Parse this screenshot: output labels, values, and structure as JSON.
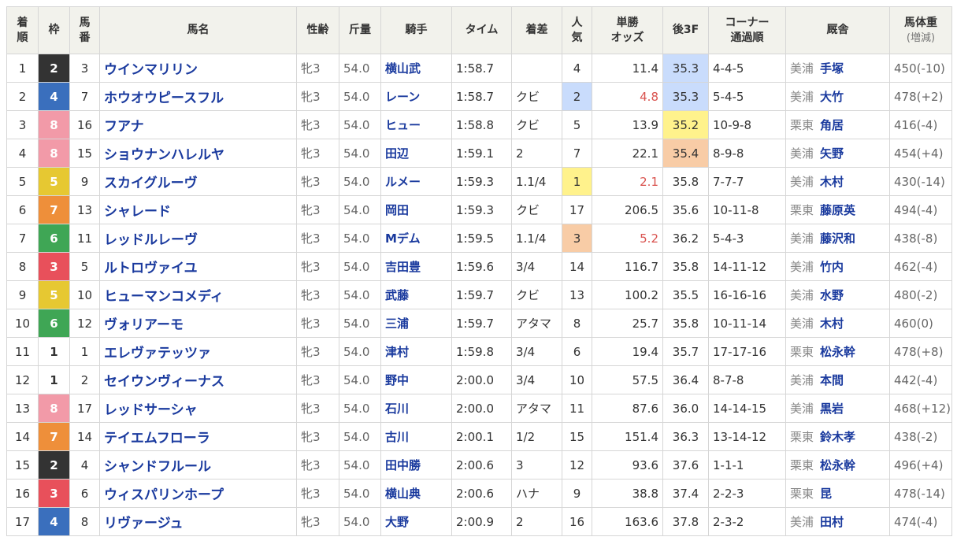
{
  "colors": {
    "waku": {
      "1": "#ffffff",
      "2": "#333333",
      "3": "#e8505b",
      "4": "#3a6fbd",
      "5": "#e6c832",
      "6": "#3fa655",
      "7": "#ee8f3a",
      "8": "#f29aa8"
    },
    "rank_highlight": {
      "1": "#fff28c",
      "2": "#c9dcfc",
      "3": "#f8cca6"
    },
    "link": "#1a3a9e",
    "favorite_odds": "#d9534f",
    "header_bg": "#f2f2ec"
  },
  "header": {
    "rank": [
      "着",
      "順"
    ],
    "waku": "枠",
    "umaban": [
      "馬",
      "番"
    ],
    "name": "馬名",
    "sex_age": "性齢",
    "weight": "斤量",
    "jockey": "騎手",
    "time": "タイム",
    "margin": "着差",
    "popularity": [
      "人",
      "気"
    ],
    "odds": [
      "単勝",
      "オッズ"
    ],
    "last3f": "後3F",
    "corners": [
      "コーナー",
      "通過順"
    ],
    "stable": "厩舎",
    "body_weight": [
      "馬体重",
      "(増減)"
    ]
  },
  "rows": [
    {
      "rank": "1",
      "waku": "2",
      "umaban": "3",
      "name": "ウインマリリン",
      "sex_age": "牝3",
      "weight": "54.0",
      "jockey": "横山武",
      "time": "1:58.7",
      "margin": "",
      "pop": "4",
      "odds": "11.4",
      "last3f": "35.3",
      "corners": "4-4-5",
      "loc": "美浦",
      "trainer": "手塚",
      "body": "450(-10)",
      "pop_rank": 0,
      "f3_rank": 2
    },
    {
      "rank": "2",
      "waku": "4",
      "umaban": "7",
      "name": "ホウオウピースフル",
      "sex_age": "牝3",
      "weight": "54.0",
      "jockey": "レーン",
      "time": "1:58.7",
      "margin": "クビ",
      "pop": "2",
      "odds": "4.8",
      "last3f": "35.3",
      "corners": "5-4-5",
      "loc": "美浦",
      "trainer": "大竹",
      "body": "478(+2)",
      "pop_rank": 2,
      "f3_rank": 2
    },
    {
      "rank": "3",
      "waku": "8",
      "umaban": "16",
      "name": "フアナ",
      "sex_age": "牝3",
      "weight": "54.0",
      "jockey": "ヒュー",
      "time": "1:58.8",
      "margin": "クビ",
      "pop": "5",
      "odds": "13.9",
      "last3f": "35.2",
      "corners": "10-9-8",
      "loc": "栗東",
      "trainer": "角居",
      "body": "416(-4)",
      "pop_rank": 0,
      "f3_rank": 1
    },
    {
      "rank": "4",
      "waku": "8",
      "umaban": "15",
      "name": "ショウナンハレルヤ",
      "sex_age": "牝3",
      "weight": "54.0",
      "jockey": "田辺",
      "time": "1:59.1",
      "margin": "2",
      "pop": "7",
      "odds": "22.1",
      "last3f": "35.4",
      "corners": "8-9-8",
      "loc": "美浦",
      "trainer": "矢野",
      "body": "454(+4)",
      "pop_rank": 0,
      "f3_rank": 3
    },
    {
      "rank": "5",
      "waku": "5",
      "umaban": "9",
      "name": "スカイグルーヴ",
      "sex_age": "牝3",
      "weight": "54.0",
      "jockey": "ルメー",
      "time": "1:59.3",
      "margin": "1.1/4",
      "pop": "1",
      "odds": "2.1",
      "last3f": "35.8",
      "corners": "7-7-7",
      "loc": "美浦",
      "trainer": "木村",
      "body": "430(-14)",
      "pop_rank": 1,
      "f3_rank": 0
    },
    {
      "rank": "6",
      "waku": "7",
      "umaban": "13",
      "name": "シャレード",
      "sex_age": "牝3",
      "weight": "54.0",
      "jockey": "岡田",
      "time": "1:59.3",
      "margin": "クビ",
      "pop": "17",
      "odds": "206.5",
      "last3f": "35.6",
      "corners": "10-11-8",
      "loc": "栗東",
      "trainer": "藤原英",
      "body": "494(-4)",
      "pop_rank": 0,
      "f3_rank": 0
    },
    {
      "rank": "7",
      "waku": "6",
      "umaban": "11",
      "name": "レッドルレーヴ",
      "sex_age": "牝3",
      "weight": "54.0",
      "jockey": "Mデム",
      "time": "1:59.5",
      "margin": "1.1/4",
      "pop": "3",
      "odds": "5.2",
      "last3f": "36.2",
      "corners": "5-4-3",
      "loc": "美浦",
      "trainer": "藤沢和",
      "body": "438(-8)",
      "pop_rank": 3,
      "f3_rank": 0
    },
    {
      "rank": "8",
      "waku": "3",
      "umaban": "5",
      "name": "ルトロヴァイユ",
      "sex_age": "牝3",
      "weight": "54.0",
      "jockey": "吉田豊",
      "time": "1:59.6",
      "margin": "3/4",
      "pop": "14",
      "odds": "116.7",
      "last3f": "35.8",
      "corners": "14-11-12",
      "loc": "美浦",
      "trainer": "竹内",
      "body": "462(-4)",
      "pop_rank": 0,
      "f3_rank": 0
    },
    {
      "rank": "9",
      "waku": "5",
      "umaban": "10",
      "name": "ヒューマンコメディ",
      "sex_age": "牝3",
      "weight": "54.0",
      "jockey": "武藤",
      "time": "1:59.7",
      "margin": "クビ",
      "pop": "13",
      "odds": "100.2",
      "last3f": "35.5",
      "corners": "16-16-16",
      "loc": "美浦",
      "trainer": "水野",
      "body": "480(-2)",
      "pop_rank": 0,
      "f3_rank": 0
    },
    {
      "rank": "10",
      "waku": "6",
      "umaban": "12",
      "name": "ヴォリアーモ",
      "sex_age": "牝3",
      "weight": "54.0",
      "jockey": "三浦",
      "time": "1:59.7",
      "margin": "アタマ",
      "pop": "8",
      "odds": "25.7",
      "last3f": "35.8",
      "corners": "10-11-14",
      "loc": "美浦",
      "trainer": "木村",
      "body": "460(0)",
      "pop_rank": 0,
      "f3_rank": 0
    },
    {
      "rank": "11",
      "waku": "1",
      "umaban": "1",
      "name": "エレヴァテッツァ",
      "sex_age": "牝3",
      "weight": "54.0",
      "jockey": "津村",
      "time": "1:59.8",
      "margin": "3/4",
      "pop": "6",
      "odds": "19.4",
      "last3f": "35.7",
      "corners": "17-17-16",
      "loc": "栗東",
      "trainer": "松永幹",
      "body": "478(+8)",
      "pop_rank": 0,
      "f3_rank": 0
    },
    {
      "rank": "12",
      "waku": "1",
      "umaban": "2",
      "name": "セイウンヴィーナス",
      "sex_age": "牝3",
      "weight": "54.0",
      "jockey": "野中",
      "time": "2:00.0",
      "margin": "3/4",
      "pop": "10",
      "odds": "57.5",
      "last3f": "36.4",
      "corners": "8-7-8",
      "loc": "美浦",
      "trainer": "本間",
      "body": "442(-4)",
      "pop_rank": 0,
      "f3_rank": 0
    },
    {
      "rank": "13",
      "waku": "8",
      "umaban": "17",
      "name": "レッドサーシャ",
      "sex_age": "牝3",
      "weight": "54.0",
      "jockey": "石川",
      "time": "2:00.0",
      "margin": "アタマ",
      "pop": "11",
      "odds": "87.6",
      "last3f": "36.0",
      "corners": "14-14-15",
      "loc": "美浦",
      "trainer": "黒岩",
      "body": "468(+12)",
      "pop_rank": 0,
      "f3_rank": 0
    },
    {
      "rank": "14",
      "waku": "7",
      "umaban": "14",
      "name": "テイエムフローラ",
      "sex_age": "牝3",
      "weight": "54.0",
      "jockey": "古川",
      "time": "2:00.1",
      "margin": "1/2",
      "pop": "15",
      "odds": "151.4",
      "last3f": "36.3",
      "corners": "13-14-12",
      "loc": "栗東",
      "trainer": "鈴木孝",
      "body": "438(-2)",
      "pop_rank": 0,
      "f3_rank": 0
    },
    {
      "rank": "15",
      "waku": "2",
      "umaban": "4",
      "name": "シャンドフルール",
      "sex_age": "牝3",
      "weight": "54.0",
      "jockey": "田中勝",
      "time": "2:00.6",
      "margin": "3",
      "pop": "12",
      "odds": "93.6",
      "last3f": "37.6",
      "corners": "1-1-1",
      "loc": "栗東",
      "trainer": "松永幹",
      "body": "496(+4)",
      "pop_rank": 0,
      "f3_rank": 0
    },
    {
      "rank": "16",
      "waku": "3",
      "umaban": "6",
      "name": "ウィスパリンホープ",
      "sex_age": "牝3",
      "weight": "54.0",
      "jockey": "横山典",
      "time": "2:00.6",
      "margin": "ハナ",
      "pop": "9",
      "odds": "38.8",
      "last3f": "37.4",
      "corners": "2-2-3",
      "loc": "栗東",
      "trainer": "昆",
      "body": "478(-14)",
      "pop_rank": 0,
      "f3_rank": 0
    },
    {
      "rank": "17",
      "waku": "4",
      "umaban": "8",
      "name": "リヴァージュ",
      "sex_age": "牝3",
      "weight": "54.0",
      "jockey": "大野",
      "time": "2:00.9",
      "margin": "2",
      "pop": "16",
      "odds": "163.6",
      "last3f": "37.8",
      "corners": "2-3-2",
      "loc": "美浦",
      "trainer": "田村",
      "body": "474(-4)",
      "pop_rank": 0,
      "f3_rank": 0
    }
  ]
}
